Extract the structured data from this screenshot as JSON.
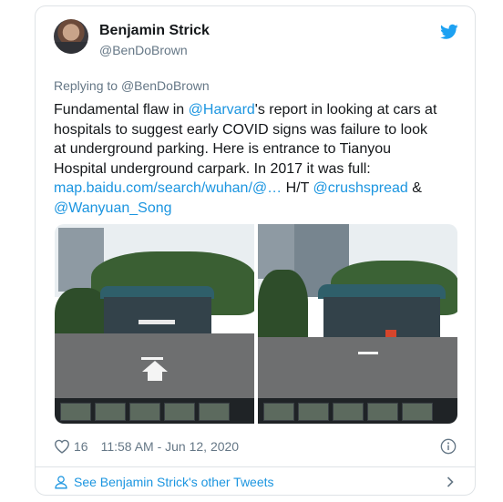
{
  "tweet": {
    "author_name": "Benjamin Strick",
    "author_handle": "@BenDoBrown",
    "reply_prefix": "Replying to",
    "reply_to": "@BenDoBrown",
    "lines": [
      [
        {
          "t": "Fundamental flaw in ",
          "link": false
        },
        {
          "t": "@Harvard",
          "link": true
        },
        {
          "t": "'s report in looking at cars at",
          "link": false
        }
      ],
      [
        {
          "t": "hospitals to suggest early COVID signs was failure to look",
          "link": false
        }
      ],
      [
        {
          "t": "at underground parking. Here is entrance to Tianyou",
          "link": false
        }
      ],
      [
        {
          "t": "Hospital underground carpark. In 2017 it was full:",
          "link": false
        }
      ],
      [
        {
          "t": "map.baidu.com/search/wuhan/@…",
          "link": true
        },
        {
          "t": " H/T ",
          "link": false
        },
        {
          "t": "@crushspread",
          "link": true
        },
        {
          "t": " &",
          "link": false
        }
      ],
      [
        {
          "t": "@Wanyuan_Song",
          "link": true
        }
      ]
    ],
    "like_count": "16",
    "timestamp": "11:58 AM - Jun 12, 2020",
    "footer_label": "See Benjamin Strick's other Tweets"
  },
  "colors": {
    "link": "#1b95e0",
    "text": "#14171a",
    "secondary": "#657786",
    "border": "#dfe3e6"
  },
  "icons": {
    "brand": "twitter-bird-icon",
    "like": "heart-icon",
    "info": "info-icon",
    "person": "person-icon",
    "chevron": "chevron-right-icon"
  }
}
